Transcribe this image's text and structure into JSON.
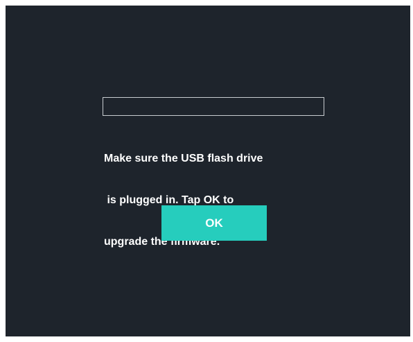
{
  "dialog": {
    "progress": 0,
    "message_lines": [
      "Make sure the USB flash drive",
      " is plugged in. Tap OK to",
      "upgrade the firmware."
    ],
    "ok_label": "OK"
  },
  "colors": {
    "background": "#1e242c",
    "accent": "#26cdbd",
    "text": "#ffffff",
    "progress_border": "#c8ccd0"
  }
}
